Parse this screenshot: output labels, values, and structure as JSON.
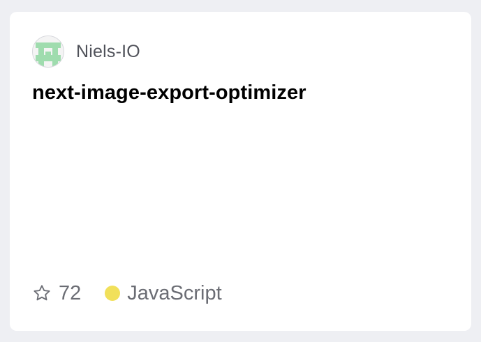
{
  "repo_card": {
    "owner": {
      "name": "Niels-IO",
      "avatar_icon": "identicon-avatar",
      "avatar_color": "#9fdcae"
    },
    "repo_name": "next-image-export-optimizer",
    "stars": {
      "icon": "star-icon",
      "count": "72"
    },
    "language": {
      "name": "JavaScript",
      "color": "#f1e05a"
    }
  }
}
